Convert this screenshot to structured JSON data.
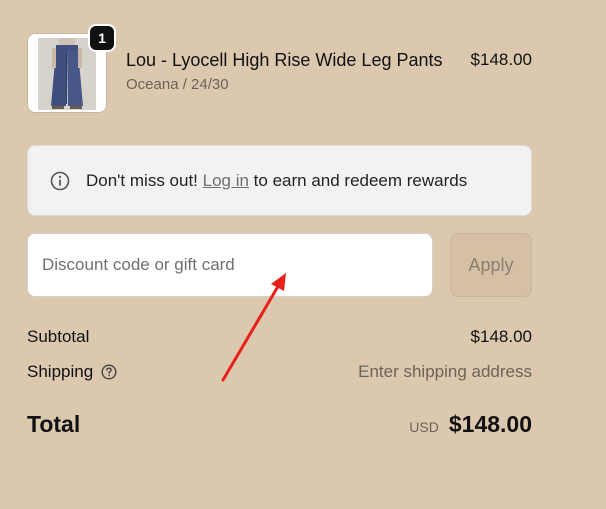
{
  "cart_item": {
    "quantity": "1",
    "name": "Lou - Lyocell High Rise Wide Leg Pants",
    "variant": "Oceana / 24/30",
    "price": "$148.00"
  },
  "rewards_banner": {
    "text_before": "Don't miss out! ",
    "link_label": "Log in",
    "text_after": " to earn and redeem rewards",
    "icon": "info-icon"
  },
  "discount": {
    "placeholder": "Discount code or gift card",
    "value": "",
    "apply_label": "Apply"
  },
  "summary": {
    "subtotal_label": "Subtotal",
    "subtotal_value": "$148.00",
    "shipping_label": "Shipping",
    "shipping_help_icon": "question-circle-icon",
    "shipping_value": "Enter shipping address",
    "total_label": "Total",
    "currency": "USD",
    "total_value": "$148.00"
  },
  "colors": {
    "page_background": "#dcc8ae",
    "banner_background": "#f2f2f2",
    "annotation_arrow": "#e8201a"
  }
}
